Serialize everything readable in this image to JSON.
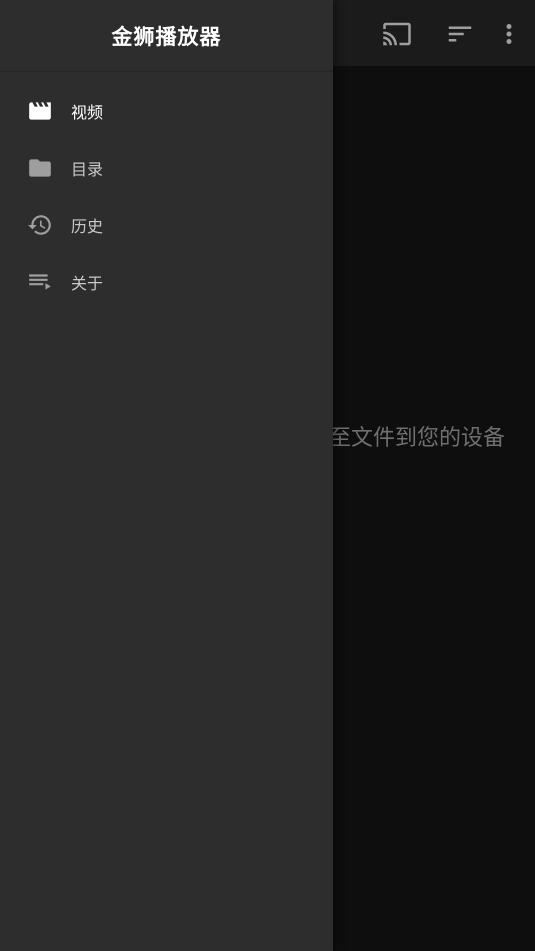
{
  "app": {
    "title": "金狮播放器"
  },
  "toolbar": {
    "icons": [
      "cast-icon",
      "sort-icon",
      "more-vert-icon"
    ]
  },
  "main": {
    "empty_hint": "…复制或下载文件到您的设备",
    "empty_hint_visible": "至文件到您的设备"
  },
  "drawer": {
    "items": [
      {
        "label": "视频",
        "icon": "movie-clapper-icon",
        "active": true
      },
      {
        "label": "目录",
        "icon": "folder-icon",
        "active": false
      },
      {
        "label": "历史",
        "icon": "history-icon",
        "active": false
      },
      {
        "label": "关于",
        "icon": "playlist-play-icon",
        "active": false
      }
    ]
  },
  "colors": {
    "drawer_bg": "#2d2d2d",
    "app_bg": "#0e0e0e",
    "appbar_bg": "#1b1b1b",
    "active_text": "#ffffff",
    "inactive_text": "#c9c9c9",
    "icon_gray": "#9e9e9e"
  }
}
